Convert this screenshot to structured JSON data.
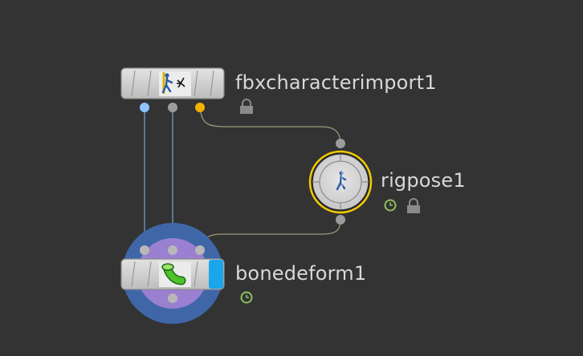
{
  "network": {
    "nodes": [
      {
        "id": "fbx",
        "label": "fbxcharacterimport1",
        "icon": "fbx-character-import-icon",
        "flags": [
          "lock"
        ]
      },
      {
        "id": "rigpose",
        "label": "rigpose1",
        "icon": "rigpose-figure-icon",
        "flags": [
          "time-dependent",
          "lock"
        ],
        "selected": true
      },
      {
        "id": "bonedeform",
        "label": "bonedeform1",
        "icon": "bone-deform-icon",
        "flags": [
          "time-dependent"
        ],
        "display_flag": true
      }
    ],
    "colors": {
      "background": "#333333",
      "wire": "#9a9a7a",
      "wire_blue": "#6f9ad0",
      "port_blue": "#8fc2ff",
      "port_gray": "#9c9c9c",
      "port_orange": "#f4b000",
      "selected_outline": "#f2cc00",
      "display_flag_blue": "#1aa6ea",
      "ring_outer": "#3f67a8",
      "ring_inner": "#9b7fd1",
      "clock_flag_green": "#8fbf60"
    }
  }
}
